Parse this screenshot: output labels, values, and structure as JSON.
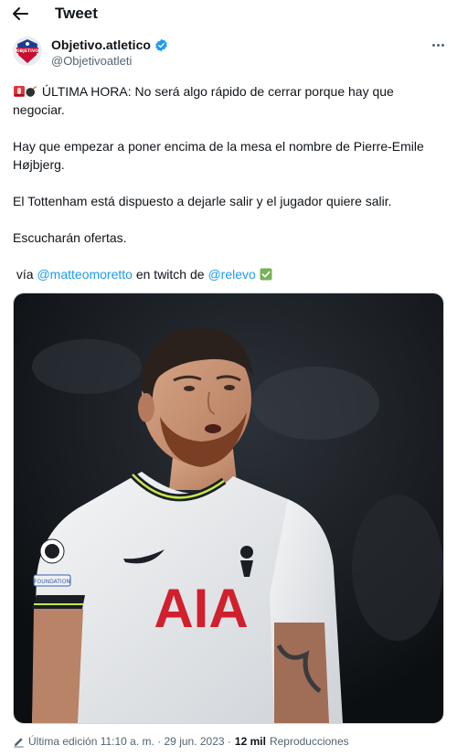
{
  "header": {
    "title": "Tweet",
    "back_icon": "arrow-left-icon"
  },
  "author": {
    "name": "Objetivo.atletico",
    "handle": "@Objetivoatleti",
    "avatar_text": "OBJETIVO",
    "verified_color": "#1d9bf0",
    "avatar_colors": {
      "top": "#1e3d8f",
      "bottom": "#c8102e"
    }
  },
  "tweet": {
    "line1_text": "ÚLTIMA HORA: No será algo rápido de cerrar porque hay que negociar.",
    "line2_text": "Hay que empezar a poner encima de la mesa el nombre de Pierre-Emile Højbjerg.",
    "line3_text": "El Tottenham está dispuesto a dejarle salir y el jugador quiere salir.",
    "line4_text": "Escucharán ofertas.",
    "credit_prefix": " vía ",
    "mention1": "@matteomoretto",
    "credit_middle": " en twitch de ",
    "mention2": "@relevo",
    "link_color": "#1d9bf0"
  },
  "media": {
    "shirt_sponsor": "AIA",
    "sponsor_color": "#d0202e",
    "patch_text": "FOUNDATION"
  },
  "footer": {
    "edited_label": "Última edición 11:10 a. m. · 29 jun. 2023 ·",
    "views_count": "12 mil",
    "views_label": "Reproducciones",
    "edit_icon": "pencil-icon"
  }
}
